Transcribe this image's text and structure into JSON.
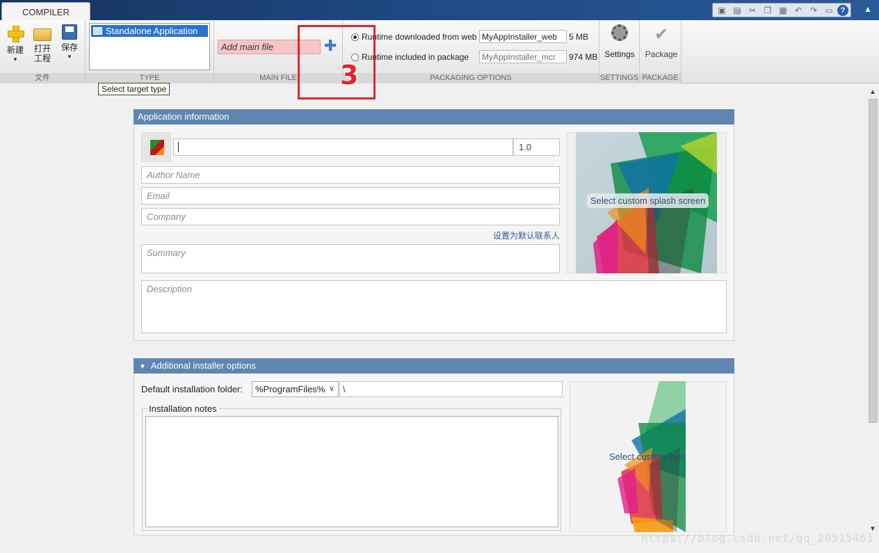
{
  "tab": {
    "label": "COMPILER"
  },
  "quick_access": {
    "icons": [
      "dock-icon",
      "save-icon",
      "cut-icon",
      "copy-icon",
      "paste-icon",
      "undo-icon",
      "redo-icon",
      "switch-windows-icon",
      "help-icon"
    ],
    "help_glyph": "?"
  },
  "ribbon": {
    "file_group": {
      "label": "文件",
      "new_label": "新建",
      "open_label1": "打开",
      "open_label2": "工程",
      "save_label": "保存"
    },
    "type_group": {
      "label": "TYPE",
      "selected_type": "Standalone Application"
    },
    "main_file_group": {
      "label": "MAIN FILE",
      "placeholder": "Add main file"
    },
    "packaging_group": {
      "label": "PACKAGING OPTIONS",
      "web_option": "Runtime downloaded from web",
      "web_value": "MyAppInstaller_web",
      "web_size": "5 MB",
      "package_option": "Runtime included in package",
      "package_value": "MyAppInstaller_mcr",
      "package_size": "974 MB"
    },
    "settings_group": {
      "label": "SETTINGS",
      "button": "Settings"
    },
    "package_group": {
      "label": "PACKAGE",
      "button": "Package"
    }
  },
  "annotation": {
    "number": "3"
  },
  "tooltip": "Select target type",
  "app_info": {
    "header": "Application information",
    "version": "1.0",
    "author_placeholder": "Author Name",
    "email_placeholder": "Email",
    "company_placeholder": "Company",
    "default_contact_link": "设置为默认联系人",
    "summary_placeholder": "Summary",
    "description_placeholder": "Description",
    "splash_label": "Select custom splash screen"
  },
  "installer": {
    "header": "Additional installer options",
    "folder_label": "Default installation folder:",
    "folder_option": "%ProgramFiles%",
    "folder_path": "\\",
    "notes_label": "Installation notes",
    "logo_label": "Select custom logo"
  },
  "watermark": "https://blog.csdn.net/qq_20515461",
  "colors": {
    "panel_header": "#5f86b0",
    "selection": "#2b73c8",
    "main_file_bg": "#f7c6c6",
    "annotation": "#e0262b"
  }
}
